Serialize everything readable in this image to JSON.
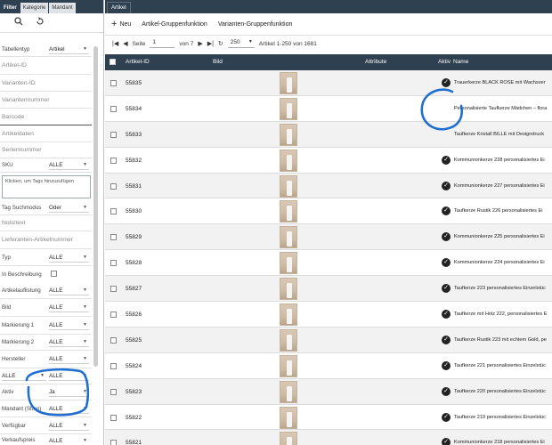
{
  "left": {
    "tabs": [
      "Filter",
      "Kategorie",
      "Mandant"
    ],
    "fields": [
      {
        "label": "Tabellentyp",
        "select": "Artikel"
      },
      {
        "label": "Artikel-ID"
      },
      {
        "label": "Varianten-ID"
      },
      {
        "label": "Variantennummer"
      },
      {
        "label": "Barcode"
      },
      {
        "label": "Artikeldaten"
      },
      {
        "label": "Seriennummer"
      },
      {
        "label": "SKU",
        "select": "ALLE"
      },
      {
        "label": "Tag Suchmodus",
        "select": "Oder"
      },
      {
        "label": "Notiztext"
      },
      {
        "label": "Lieferanten-Artikelnummer"
      },
      {
        "label": "Typ",
        "select": "ALLE"
      },
      {
        "label": "In Beschreibung"
      },
      {
        "label": "Artikelauflistung",
        "select": "ALLE"
      },
      {
        "label": "Bild",
        "select": "ALLE"
      },
      {
        "label": "Markierung 1",
        "select": "ALLE"
      },
      {
        "label": "Markierung 2",
        "select": "ALLE"
      },
      {
        "label": "Hersteller",
        "select": "ALLE"
      },
      {
        "label": "ALLE",
        "select": "ALLE"
      },
      {
        "label": "Aktiv",
        "select": "Ja"
      },
      {
        "label": "Mandant (Shop)",
        "select": "ALLE"
      },
      {
        "label": "Verfügbar",
        "select": "ALLE"
      },
      {
        "label": "Verkaufspreis",
        "select": "ALLE"
      }
    ],
    "tags_placeholder": "Klicken, um Tags hinzuzufügen"
  },
  "right": {
    "tab": "Artikel",
    "toolbar": {
      "new": "Neu",
      "group": "Artikel-Gruppenfunktion",
      "variant_group": "Varianten-Gruppenfunktion"
    },
    "pager": {
      "seite": "Seite",
      "page": "1",
      "of": "von 7",
      "size": "250",
      "range": "Artikel 1-250 von 1681"
    },
    "columns": {
      "id": "Artikel-ID",
      "bild": "Bild",
      "attr": "Attribute",
      "aktiv": "Aktiv",
      "name": "Name"
    },
    "rows": [
      {
        "id": "55835",
        "active": true,
        "name": "Trauerkerze BLACK ROSE mit Wachsver"
      },
      {
        "id": "55834",
        "active": false,
        "name": "Personalisierte Taufkerze Mädchen – flora"
      },
      {
        "id": "55833",
        "active": false,
        "name": "Taufkerze Kristall BILLE mit Designdruck"
      },
      {
        "id": "55832",
        "active": true,
        "name": "Kommunionkerze 228 personalisiertes Ei"
      },
      {
        "id": "55831",
        "active": true,
        "name": "Kommunionkerze 227 personalisiertes Ei"
      },
      {
        "id": "55830",
        "active": true,
        "name": "Taufkerze Rustik 226 personalisiertes Ei"
      },
      {
        "id": "55829",
        "active": true,
        "name": "Kommunionkerze 225 personalisiertes Ei"
      },
      {
        "id": "55828",
        "active": true,
        "name": "Kommunionkerze 224 personalisiertes Ei"
      },
      {
        "id": "55827",
        "active": true,
        "name": "Taufkerze 223 personalisiertes Einzelstüc"
      },
      {
        "id": "55826",
        "active": true,
        "name": "Taufkerze mit Holz 222, personalisiertes E"
      },
      {
        "id": "55825",
        "active": true,
        "name": "Taufkerze Rustik 223 mit echtem Gold, pe"
      },
      {
        "id": "55824",
        "active": true,
        "name": "Taufkerze 221 personalisiertes Einzelstüc"
      },
      {
        "id": "55823",
        "active": true,
        "name": "Taufkerze 220 personalisiertes Einzelstüc"
      },
      {
        "id": "55822",
        "active": true,
        "name": "Taufkerze 219 personalisiertes Einzelstüc"
      },
      {
        "id": "55821",
        "active": true,
        "name": "Kommunionkerze 218 personalisiertes Ei"
      }
    ]
  },
  "colors": {
    "header": "#2f4050",
    "annotation": "#1f6fd1"
  }
}
